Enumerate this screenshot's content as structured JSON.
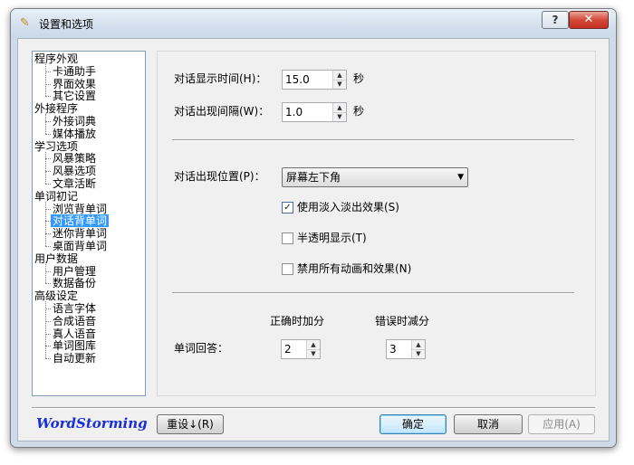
{
  "window": {
    "title": "设置和选项"
  },
  "tree": {
    "items": [
      {
        "label": "程序外观",
        "level": 0
      },
      {
        "label": "卡通助手",
        "level": 1
      },
      {
        "label": "界面效果",
        "level": 1
      },
      {
        "label": "其它设置",
        "level": 1
      },
      {
        "label": "外接程序",
        "level": 0
      },
      {
        "label": "外接词典",
        "level": 1
      },
      {
        "label": "媒体播放",
        "level": 1
      },
      {
        "label": "学习选项",
        "level": 0
      },
      {
        "label": "风暴策略",
        "level": 1
      },
      {
        "label": "风暴选项",
        "level": 1
      },
      {
        "label": "文章活断",
        "level": 1
      },
      {
        "label": "单词初记",
        "level": 0
      },
      {
        "label": "浏览背单词",
        "level": 1
      },
      {
        "label": "对话背单词",
        "level": 1,
        "selected": true
      },
      {
        "label": "迷你背单词",
        "level": 1
      },
      {
        "label": "桌面背单词",
        "level": 1
      },
      {
        "label": "用户数据",
        "level": 0
      },
      {
        "label": "用户管理",
        "level": 1
      },
      {
        "label": "数据备份",
        "level": 1
      },
      {
        "label": "高级设定",
        "level": 0
      },
      {
        "label": "语言字体",
        "level": 1
      },
      {
        "label": "合成语音",
        "level": 1
      },
      {
        "label": "真人语音",
        "level": 1
      },
      {
        "label": "单词图库",
        "level": 1
      },
      {
        "label": "自动更新",
        "level": 1
      }
    ]
  },
  "panel": {
    "display_time": {
      "label": "对话显示时间(H)：",
      "value": "15.0",
      "unit": "秒"
    },
    "interval": {
      "label": "对话出现间隔(W)：",
      "value": "1.0",
      "unit": "秒"
    },
    "position": {
      "label": "对话出现位置(P)：",
      "value": "屏幕左下角"
    },
    "fade": {
      "label": "使用淡入淡出效果(S)",
      "checked": true
    },
    "translucent": {
      "label": "半透明显示(T)",
      "checked": false
    },
    "disable_anim": {
      "label": "禁用所有动画和效果(N)",
      "checked": false
    },
    "answer": {
      "label": "单词回答：",
      "correct_header": "正确时加分",
      "wrong_header": "错误时减分",
      "correct_value": "2",
      "wrong_value": "3"
    }
  },
  "footer": {
    "brand": "WordStorming",
    "reset_label": "重设↓(R)",
    "ok_label": "确定",
    "cancel_label": "取消",
    "apply_label": "应用(A)"
  },
  "icons": {
    "app": "wand-icon",
    "help": "help-icon",
    "close": "close-icon",
    "check": "checkmark-icon"
  }
}
